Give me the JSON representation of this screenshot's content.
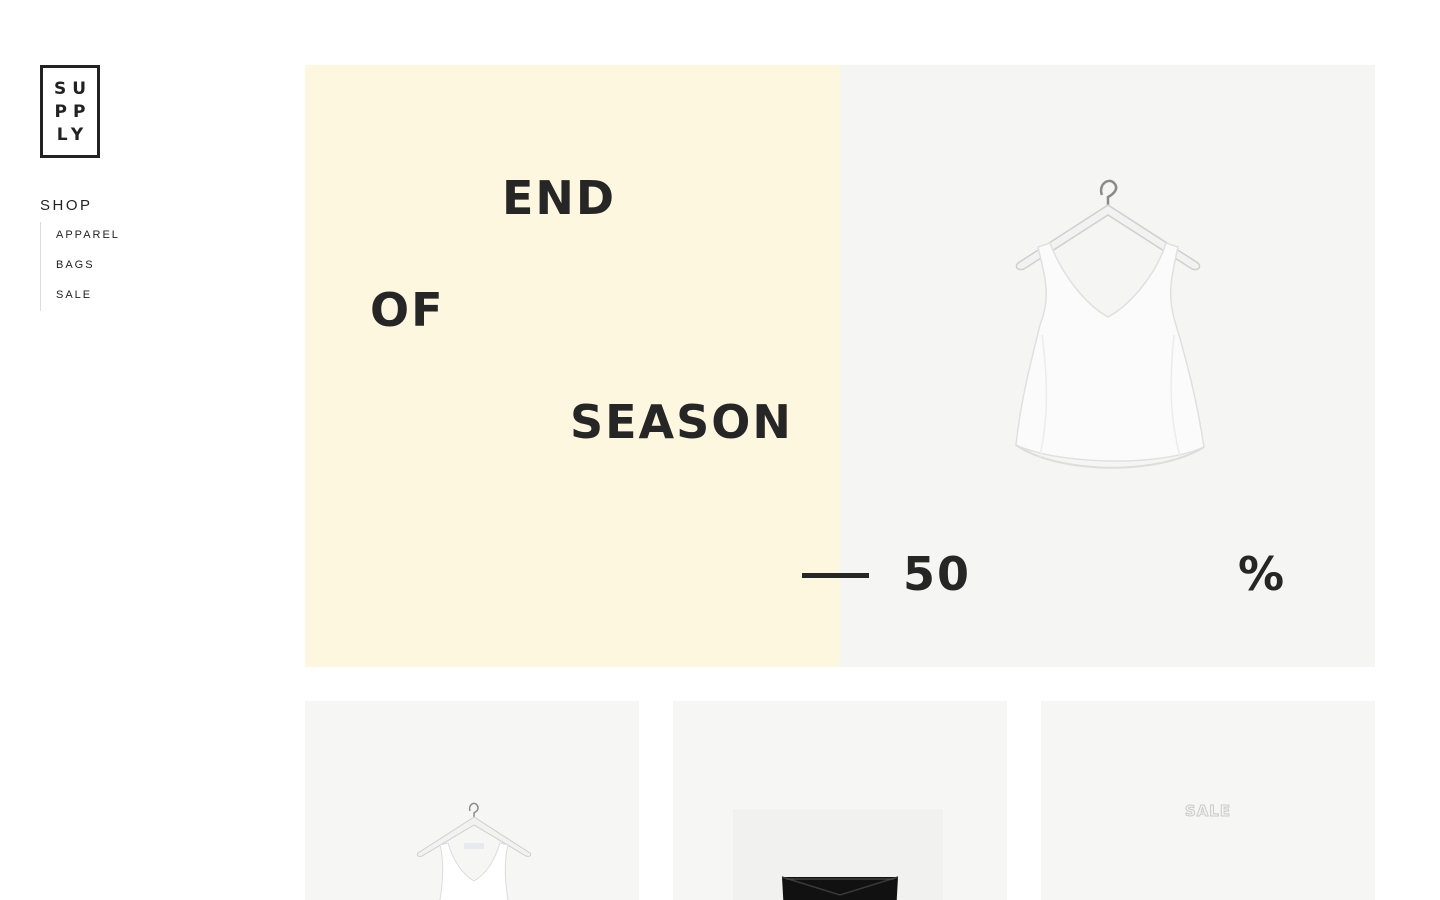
{
  "logo": {
    "lines": [
      "SU",
      "PP",
      "LY"
    ]
  },
  "sidebar": {
    "heading": "SHOP",
    "items": [
      {
        "label": "APPAREL"
      },
      {
        "label": "BAGS"
      },
      {
        "label": "SALE"
      }
    ]
  },
  "hero": {
    "words": [
      "END",
      "OF",
      "SEASON"
    ],
    "discount_number": "50",
    "discount_symbol": "%",
    "colors": {
      "left_panel": "#fdf7df",
      "right_panel": "#f5f5f3",
      "text": "#262626"
    },
    "image": "white-tank-top-on-hanger"
  },
  "products": [
    {
      "image": "white-tank-top-on-hanger"
    },
    {
      "image": "black-leather-clutch-bag"
    },
    {
      "label": "SALE"
    }
  ]
}
